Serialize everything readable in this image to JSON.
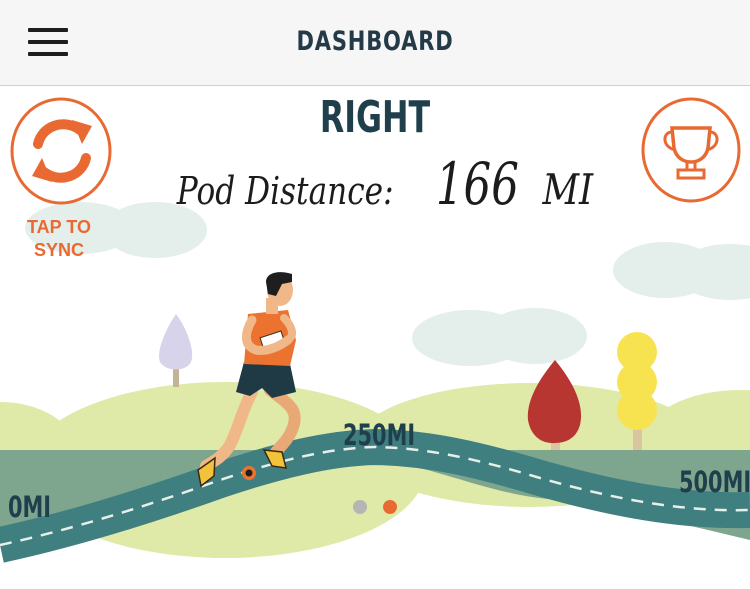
{
  "header": {
    "title": "DASHBOARD",
    "menu_icon": "hamburger-menu-icon"
  },
  "sync": {
    "label_line1": "TAP TO",
    "label_line2": "SYNC",
    "icon": "sync-arrows-icon"
  },
  "trophy": {
    "icon": "trophy-icon"
  },
  "pod": {
    "side": "RIGHT",
    "distance_label": "Pod Distance:",
    "distance_value": "166",
    "distance_unit": "MI"
  },
  "track": {
    "markers": [
      {
        "label": "0MI"
      },
      {
        "label": "250MI"
      },
      {
        "label": "500MI"
      }
    ],
    "progress_miles": 166
  },
  "pagination": {
    "count": 2,
    "active_index": 1
  },
  "colors": {
    "accent_orange": "#e86a32",
    "title_dark": "#1e3f4b",
    "road_teal": "#3f7f7f",
    "grass": "#7ea58e",
    "hill": "#dfe9a8",
    "cloud": "#e4efec"
  }
}
